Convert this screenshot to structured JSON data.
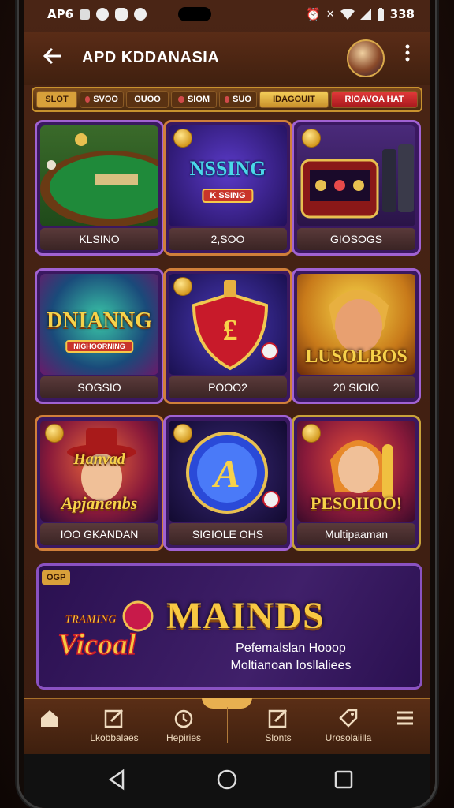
{
  "status_bar": {
    "left_text": "AP6",
    "right_text": "338"
  },
  "app_bar": {
    "back_icon": "arrow-left-icon",
    "title": "APD KDDANASIA"
  },
  "filters": [
    {
      "label": "SLOT",
      "style": "first"
    },
    {
      "label": "SVOO",
      "style": "plain"
    },
    {
      "label": "OUOO",
      "style": "plain"
    },
    {
      "label": "SIOM",
      "style": "plain"
    },
    {
      "label": "SUO",
      "style": "plain"
    },
    {
      "label": "IDAGOUIT",
      "style": "gold"
    },
    {
      "label": "RIOAVOA HAT",
      "style": "red"
    }
  ],
  "tiles": [
    {
      "caption": "KLSINO",
      "art": "roulette"
    },
    {
      "caption": "2,SOO",
      "art_title": "NSSING",
      "art_sub": "K SSING"
    },
    {
      "caption": "GIOSOGS",
      "art": "slot-machine"
    },
    {
      "caption": "SOGSIO",
      "art_title": "DNIANNG",
      "art_sub": "NIGHOORNING"
    },
    {
      "caption": "POOO2",
      "art": "shield"
    },
    {
      "caption": "20 SIOIO",
      "art_title": "LUSOLBOS"
    },
    {
      "caption": "IOO GKANDAN",
      "art_title": "Apjanenbs",
      "art_top": "Hanvad"
    },
    {
      "caption": "SIGIOLE OHS",
      "art": "orb"
    },
    {
      "caption": "Multipaaman",
      "art_title": "PESOIIOO!"
    }
  ],
  "banner": {
    "badge": "OGP",
    "logo_text": "Vicoal",
    "logo_top": "TRAMING",
    "title": "MAINDS",
    "line1": "Pefemalslan Hooop",
    "line2": "Moltianoan Iosllaliees"
  },
  "bottom_nav": [
    {
      "label": "Lkobbalaes",
      "icon": "home-icon"
    },
    {
      "label": "Hepiries",
      "icon": "edit-icon"
    },
    {
      "label": "",
      "icon": "timer-icon"
    },
    {
      "label": "Slonts",
      "icon": "edit-icon"
    },
    {
      "label": "Urosolaiilla",
      "icon": "tag-icon"
    },
    {
      "label": "",
      "icon": "menu-icon"
    }
  ]
}
